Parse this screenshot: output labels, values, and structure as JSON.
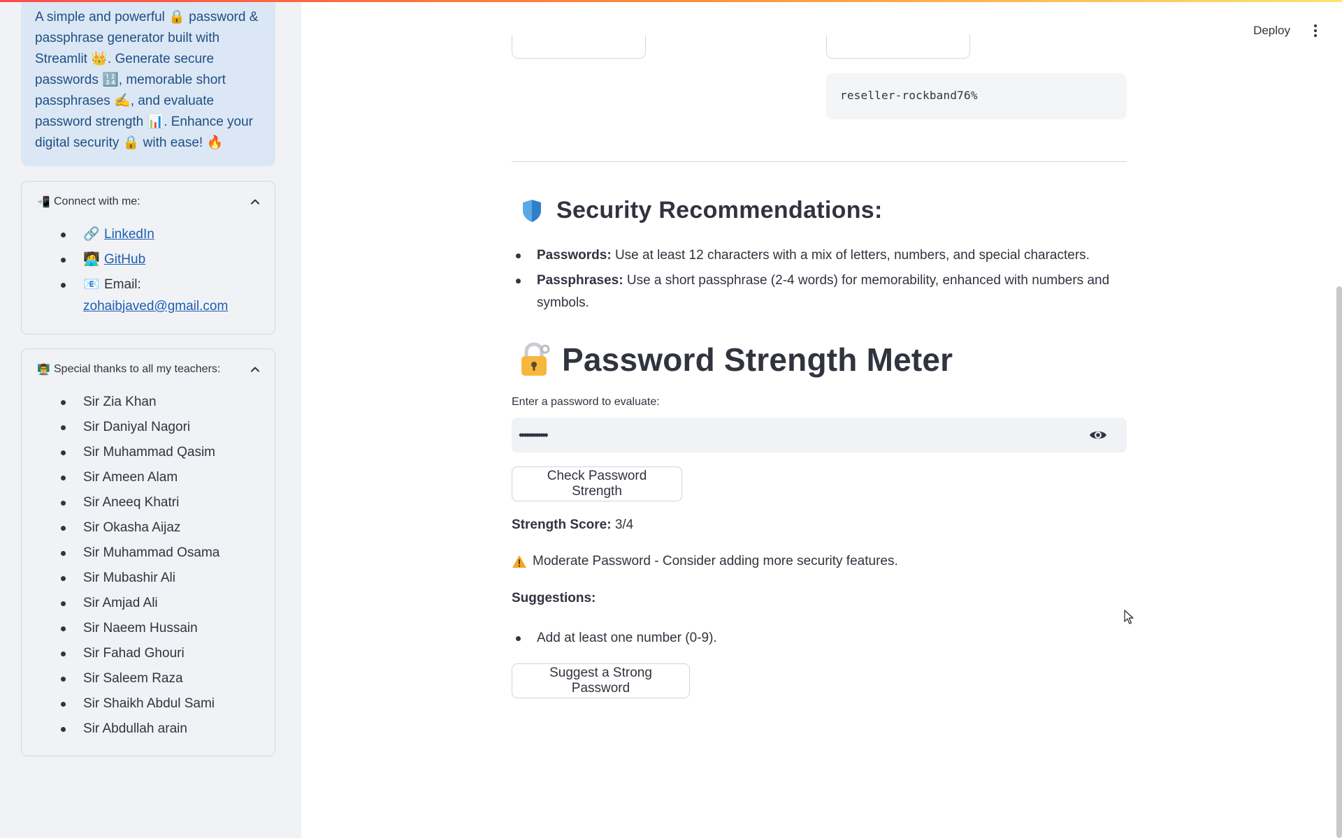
{
  "sidebar": {
    "intro": {
      "p1": "A simple and powerful",
      "p2": "password & passphrase generator built with Streamlit",
      "p3": ". Generate secure passwords",
      "p4": ", memorable short passphrases",
      "p5": ", and evaluate password strength",
      "p6": ". Enhance your digital security",
      "p7": "with ease!"
    },
    "connect": {
      "title": "Connect with me:",
      "linkedin": "LinkedIn",
      "github": "GitHub",
      "email_label": "Email:",
      "email": "zohaibjaved@gmail.com"
    },
    "teachers": {
      "title": "Special thanks to all my teachers:",
      "items": [
        "Sir Zia Khan",
        "Sir Daniyal Nagori",
        "Sir Muhammad Qasim",
        "Sir Ameen Alam",
        "Sir Aneeq Khatri",
        "Sir Okasha Aijaz",
        "Sir Muhammad Osama",
        "Sir Mubashir Ali",
        "Sir Amjad Ali",
        "Sir Naeem Hussain",
        "Sir Fahad Ghouri",
        "Sir Saleem Raza",
        "Sir Shaikh Abdul Sami",
        "Sir Abdullah arain"
      ]
    }
  },
  "toolbar": {
    "deploy": "Deploy"
  },
  "main": {
    "generated_passphrase": "reseller-rockband76%",
    "security": {
      "title": "Security Recommendations:",
      "passwords_label": "Passwords:",
      "passwords_text": "Use at least 12 characters with a mix of letters, numbers, and special characters.",
      "passphrases_label": "Passphrases:",
      "passphrases_text": "Use a short passphrase (2-4 words) for memorability, enhanced with numbers and symbols."
    },
    "meter": {
      "title": "Password Strength Meter",
      "input_label": "Enter a password to evaluate:",
      "input_value": "••••••••••••",
      "check_button": "Check Password Strength",
      "score_label": "Strength Score:",
      "score_value": "3/4",
      "result": "Moderate Password - Consider adding more security features.",
      "suggestions_title": "Suggestions:",
      "suggestions": [
        "Add at least one number (0-9)."
      ],
      "suggest_button": "Suggest a Strong Password"
    }
  },
  "colors": {
    "sidebar_bg": "#f0f2f6",
    "info_bg": "#dbe7f5",
    "info_text": "#1f4e83",
    "link": "#1c5fb3",
    "text": "#31333f",
    "warning": "#f5a623"
  },
  "icons": [
    "lock-icon",
    "crown-icon",
    "numbers-icon",
    "writing-hand-icon",
    "bar-chart-icon",
    "fire-icon",
    "phone-icon",
    "link-icon",
    "person-icon",
    "envelope-icon",
    "teacher-icon",
    "chevron-up-icon",
    "shield-icon",
    "padlock-key-icon",
    "eye-icon",
    "warning-icon",
    "kebab-menu-icon"
  ]
}
